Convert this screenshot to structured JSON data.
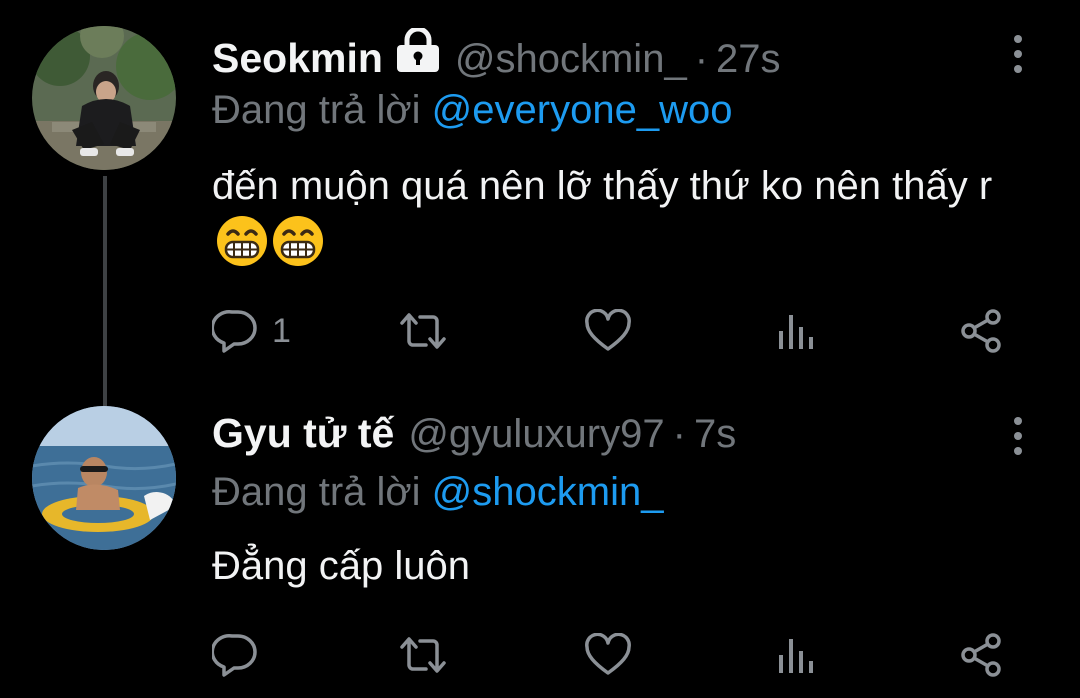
{
  "tweets": [
    {
      "display_name": "Seokmin",
      "locked": true,
      "handle": "@shockmin_",
      "separator": "·",
      "time": "27s",
      "replying_label": "Đang trả lời",
      "replying_to": "@everyone_woo",
      "text": "đến muộn quá nên lỡ thấy thứ ko nên thấy r",
      "emojis": [
        "grinning-face-with-smiling-eyes",
        "grinning-face-with-smiling-eyes"
      ],
      "reply_count": "1",
      "avatar": "avatar-seokmin"
    },
    {
      "display_name": "Gyu tử tế",
      "locked": false,
      "handle": "@gyuluxury97",
      "separator": "·",
      "time": "7s",
      "replying_label": "Đang trả lời",
      "replying_to": "@shockmin_",
      "text": "Đẳng cấp luôn",
      "emojis": [],
      "reply_count": "",
      "avatar": "avatar-gyu"
    }
  ],
  "icons": [
    "lock-icon",
    "more-icon",
    "reply-icon",
    "retweet-icon",
    "like-icon",
    "views-icon",
    "share-icon"
  ],
  "colors": {
    "background": "#000000",
    "text": "#e7e9ea",
    "secondary": "#71767b",
    "accent": "#1d9bf0"
  }
}
